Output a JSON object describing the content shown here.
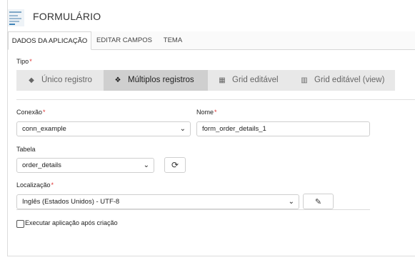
{
  "header": {
    "title": "FORMULÁRIO"
  },
  "tabs": [
    {
      "label": "DADOS DA APLICAÇÃO",
      "active": true
    },
    {
      "label": "EDITAR CAMPOS",
      "active": false
    },
    {
      "label": "TEMA",
      "active": false
    }
  ],
  "tipo": {
    "label": "Tipo",
    "required_mark": "*",
    "options": [
      {
        "label": "Único registro",
        "icon": "cube-icon",
        "active": false
      },
      {
        "label": "Múltiplos registros",
        "icon": "cubes-icon",
        "active": true
      },
      {
        "label": "Grid editável",
        "icon": "table-grid-icon",
        "active": false
      },
      {
        "label": "Grid editável (view)",
        "icon": "columns-icon",
        "active": false
      }
    ]
  },
  "conexao": {
    "label": "Conexão",
    "required_mark": "*",
    "value": "conn_example"
  },
  "nome": {
    "label": "Nome",
    "required_mark": "*",
    "value": "form_order_details_1"
  },
  "tabela": {
    "label": "Tabela",
    "value": "order_details",
    "refresh_icon": "refresh-icon"
  },
  "localizacao": {
    "label": "Localização",
    "required_mark": "*",
    "value": "Inglês (Estados Unidos) - UTF-8",
    "edit_icon": "edit-icon"
  },
  "executar": {
    "label": "Executar aplicação após criação",
    "checked": false
  },
  "colors": {
    "accent_required": "#dd3333",
    "active_type_bg": "#cfcfcf",
    "type_bar_bg": "#e8e8e8"
  }
}
